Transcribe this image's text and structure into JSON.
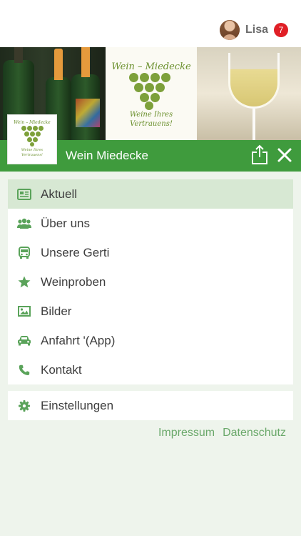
{
  "user": {
    "name": "Lisa",
    "notifications": "7",
    "avatar_icon": "user-avatar"
  },
  "banner": {
    "brand_title": "Wein – Miedecke",
    "brand_tagline_line1": "Weine Ihres",
    "brand_tagline_line2": "Vertrauens!"
  },
  "header": {
    "title": "Wein Miedecke",
    "share_icon": "share-icon",
    "close_icon": "close-icon",
    "accent_color": "#3f9b3d"
  },
  "menu": {
    "items": [
      {
        "label": "Aktuell",
        "icon": "newspaper-icon",
        "active": true
      },
      {
        "label": "Über uns",
        "icon": "users-icon",
        "active": false
      },
      {
        "label": "Unsere Gerti",
        "icon": "bus-icon",
        "active": false
      },
      {
        "label": "Weinproben",
        "icon": "star-icon",
        "active": false
      },
      {
        "label": "Bilder",
        "icon": "image-icon",
        "active": false
      },
      {
        "label": "Anfahrt '(App)",
        "icon": "car-icon",
        "active": false
      },
      {
        "label": "Kontakt",
        "icon": "phone-icon",
        "active": false
      }
    ],
    "settings": {
      "label": "Einstellungen",
      "icon": "gear-icon"
    }
  },
  "footer": {
    "impressum": "Impressum",
    "datenschutz": "Datenschutz"
  },
  "colors": {
    "icon": "#5aa35a",
    "active_bg": "#d7e8d3",
    "background": "#eef4ec",
    "badge": "#e01f26"
  }
}
